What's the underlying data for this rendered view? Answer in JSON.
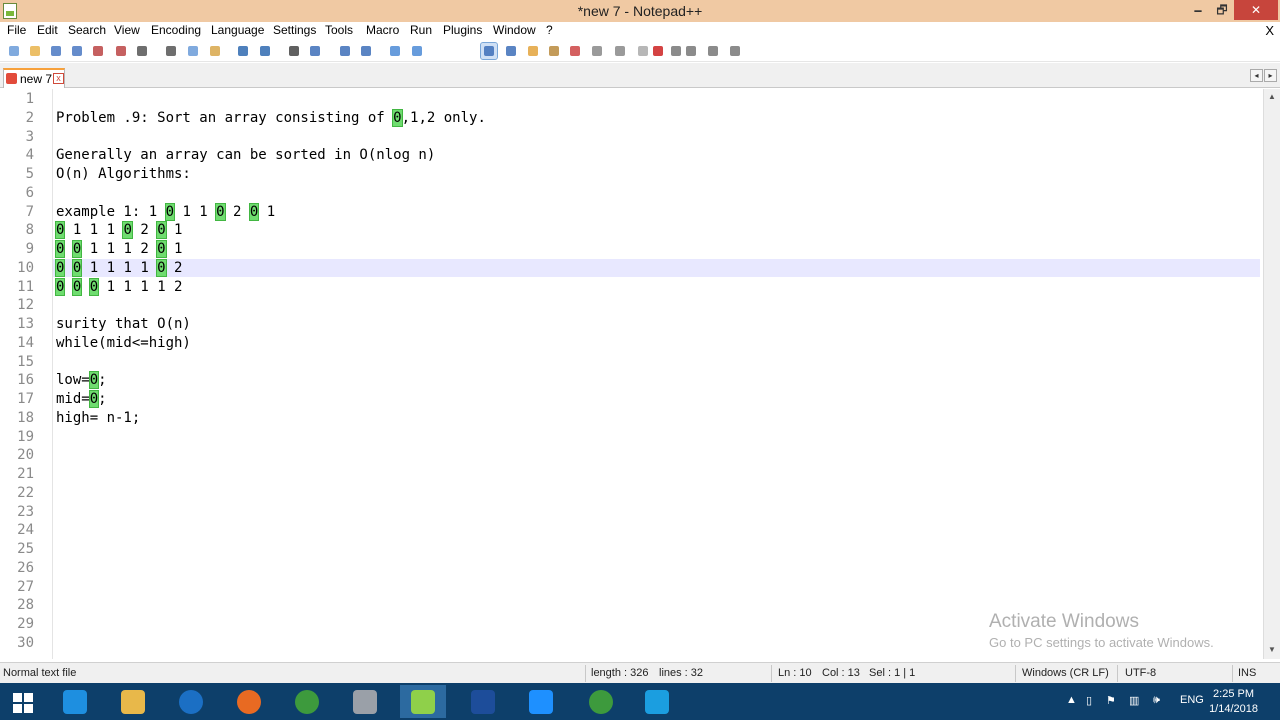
{
  "window": {
    "title": "*new 7 - Notepad++",
    "min": "🗕",
    "max": "🗗",
    "close": "✕"
  },
  "menu": {
    "items": [
      "File",
      "Edit",
      "Search",
      "View",
      "Encoding",
      "Language",
      "Settings",
      "Tools",
      "Macro",
      "Run",
      "Plugins",
      "Window",
      "?"
    ],
    "close_x": "X"
  },
  "toolbar": {
    "icons": [
      "new-file-icon",
      "open-file-icon",
      "save-icon",
      "save-all-icon",
      "close-icon",
      "close-all-icon",
      "print-icon",
      "cut-icon",
      "copy-icon",
      "paste-icon",
      "undo-icon",
      "redo-icon",
      "find-icon",
      "replace-icon",
      "zoom-in-icon",
      "zoom-out-icon",
      "sync-vertical-icon",
      "sync-horizontal-icon",
      "word-wrap-icon",
      "show-all-chars-icon",
      "indent-guide-icon",
      "user-lang-icon",
      "doc-map-icon",
      "function-list-icon",
      "folder-workspace-icon",
      "monitoring-icon",
      "record-macro-icon",
      "stop-record-icon",
      "play-macro-icon",
      "run-macro-multiple-icon",
      "save-macro-icon"
    ]
  },
  "tab": {
    "label": "new 7",
    "close": "x"
  },
  "editor": {
    "line_numbers": [
      "1",
      "2",
      "3",
      "4",
      "5",
      "6",
      "7",
      "8",
      "9",
      "10",
      "11",
      "12",
      "13",
      "14",
      "15",
      "16",
      "17",
      "18",
      "19",
      "20",
      "21",
      "22",
      "23",
      "24",
      "25",
      "26",
      "27",
      "28",
      "29",
      "30"
    ],
    "current_line": 10,
    "lines": [
      "",
      "Problem .9: Sort an array consisting of 0,1,2 only.",
      "",
      "Generally an array can be sorted in O(nlog n)",
      "O(n) Algorithms:",
      "",
      "example 1: 1 0 1 1 0 2 0 1",
      "0 1 1 1 0 2 0 1",
      "0 0 1 1 1 2 0 1",
      "0 0 1 1 1 1 0 2",
      "0 0 0 1 1 1 1 2",
      "",
      "surity that O(n)",
      "while(mid<=high)",
      "",
      "low=0;",
      "mid=0;",
      "high= n-1;",
      "",
      "",
      "",
      "",
      "",
      "",
      "",
      "",
      "",
      "",
      "",
      ""
    ]
  },
  "watermark": {
    "heading": "Activate Windows",
    "sub": "Go to PC settings to activate Windows."
  },
  "status": {
    "file_type": "Normal text file",
    "length": "length : 326",
    "lines": "lines : 32",
    "ln": "Ln : 10",
    "col": "Col : 13",
    "sel": "Sel : 1 | 1",
    "eol": "Windows (CR LF)",
    "encoding": "UTF-8",
    "mode": "INS"
  },
  "taskbar": {
    "apps": [
      "start-icon",
      "internet-explorer-icon",
      "file-explorer-icon",
      "chrome-canary-icon",
      "firefox-icon",
      "chrome-icon",
      "printer-app-icon",
      "notepad-plus-plus-icon",
      "dev-cpp-icon",
      "snipping-tool-icon",
      "chrome-profile-icon",
      "skype-icon"
    ],
    "lang": "ENG",
    "time": "2:25 PM",
    "date": "1/14/2018"
  },
  "colors": {
    "titlebar": "#f0c9a3",
    "highlight_zero": "#6fdc6f",
    "current_line": "#e8e8ff",
    "taskbar": "#0d3f6a"
  }
}
